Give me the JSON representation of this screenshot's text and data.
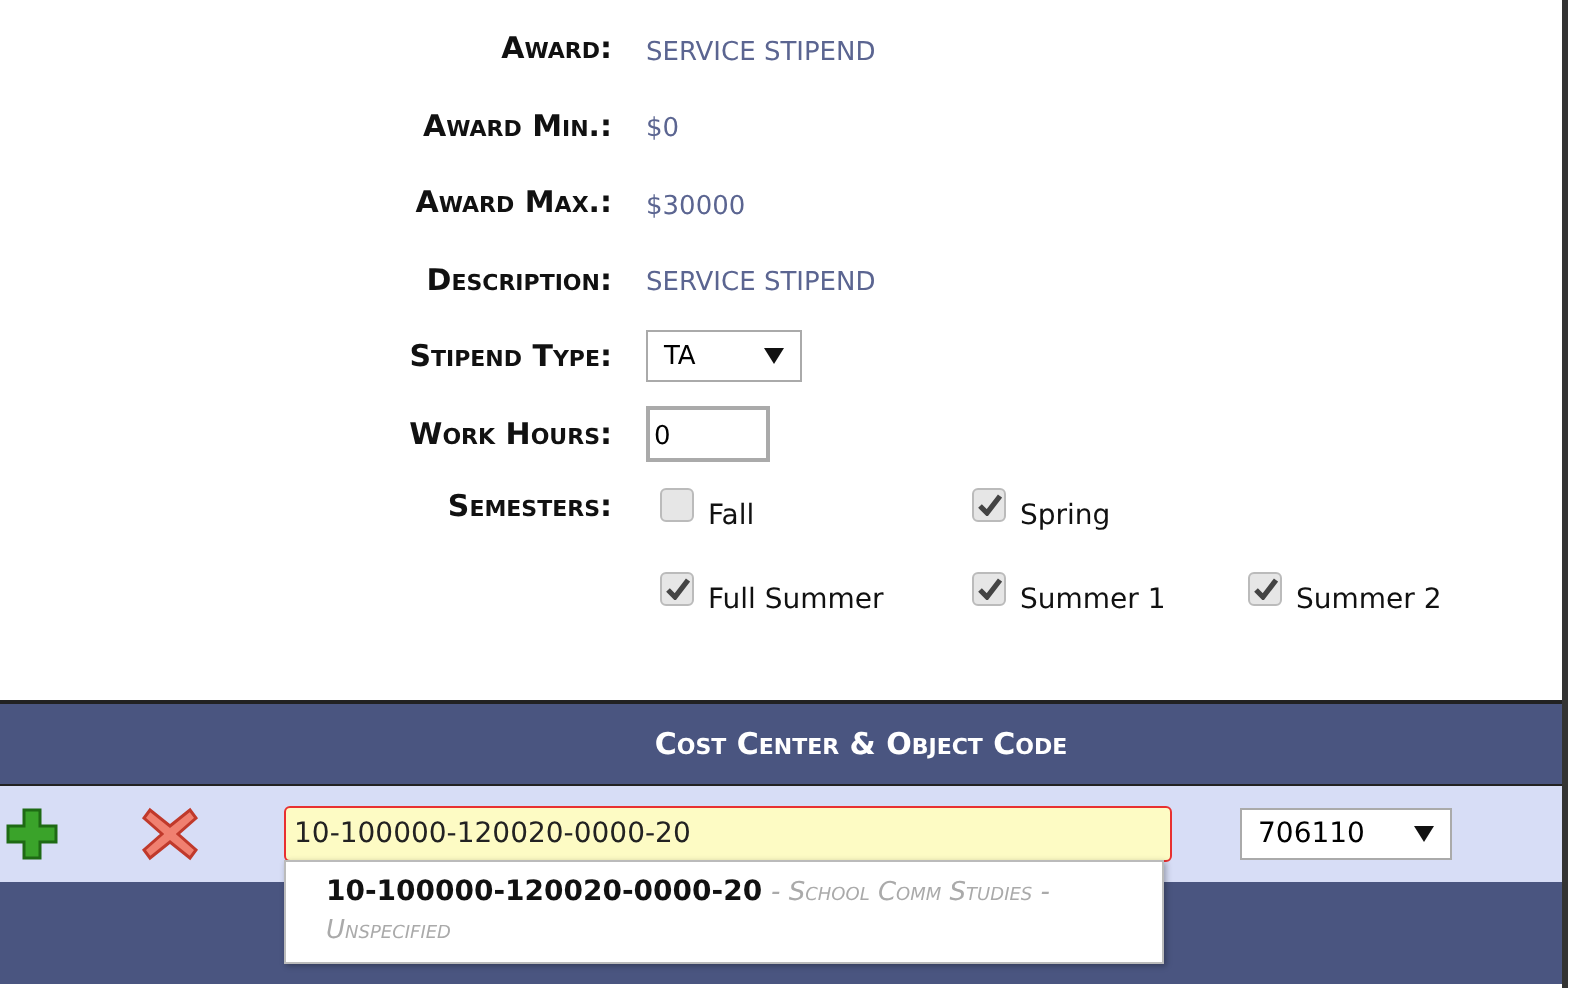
{
  "fields": [
    {
      "label": "Award:",
      "kind": "text",
      "value": "SERVICE STIPEND"
    },
    {
      "label": "Award Min.:",
      "kind": "text",
      "value": "$0"
    },
    {
      "label": "Award Max.:",
      "kind": "text",
      "value": "$30000"
    },
    {
      "label": "Description:",
      "kind": "text",
      "value": "SERVICE STIPEND"
    },
    {
      "label": "Stipend Type:",
      "kind": "select",
      "value": "TA"
    },
    {
      "label": "Work Hours:",
      "kind": "input",
      "value": "0"
    }
  ],
  "semesters": {
    "label": "Semesters:",
    "options": [
      {
        "label": "Fall",
        "checked": false
      },
      {
        "label": "Spring",
        "checked": true
      },
      {
        "label": "Full Summer",
        "checked": true
      },
      {
        "label": "Summer 1",
        "checked": true
      },
      {
        "label": "Summer 2",
        "checked": true
      }
    ]
  },
  "cost_center": {
    "title": "Cost Center & Object Code",
    "code_field": {
      "value": "10-100000-120020-0000-20"
    },
    "object_code": {
      "value": "706110"
    },
    "suggestions": [
      {
        "code": "10-100000-120020-0000-20",
        "description": "- School Comm Studies - Unspecified"
      }
    ]
  }
}
